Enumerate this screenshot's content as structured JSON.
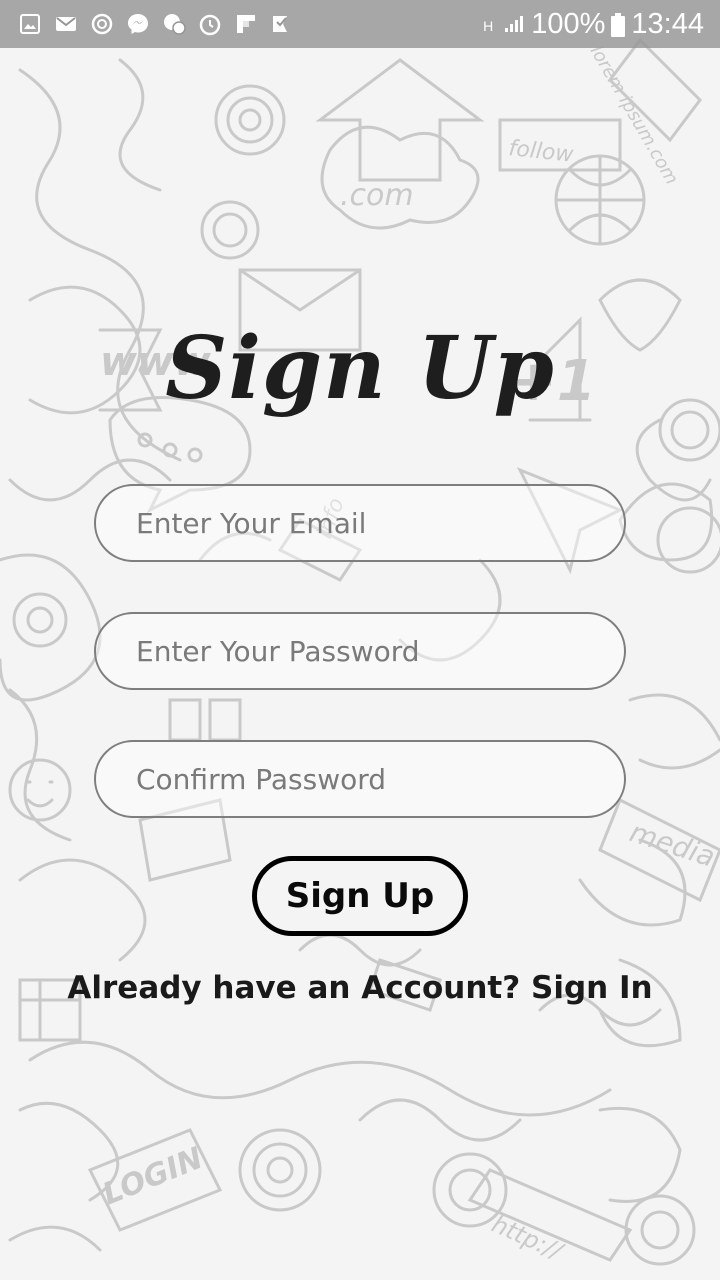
{
  "status_bar": {
    "battery": "100%",
    "time": "13:44",
    "network": "H",
    "icons": [
      "gallery-icon",
      "mail-icon",
      "sync-icon",
      "messenger-icon",
      "app-icon",
      "timer-icon",
      "flipboard-icon",
      "app-icon-2"
    ]
  },
  "title": "Sign Up",
  "form": {
    "email_placeholder": "Enter Your Email",
    "password_placeholder": "Enter Your Password",
    "confirm_placeholder": "Confirm Password",
    "submit_label": "Sign Up"
  },
  "signin_link": "Already have an Account? Sign In",
  "background": {
    "doodle_words": [
      ".com",
      "follow",
      "www",
      "media",
      "LOGIN",
      "http://",
      "info",
      "lorem ipsum.com",
      "+1"
    ]
  },
  "colors": {
    "page_background": "#f4f4f4",
    "doodle_stroke": "#c9c9c9",
    "status_bar": "#969696",
    "text": "#1e1e1e"
  }
}
